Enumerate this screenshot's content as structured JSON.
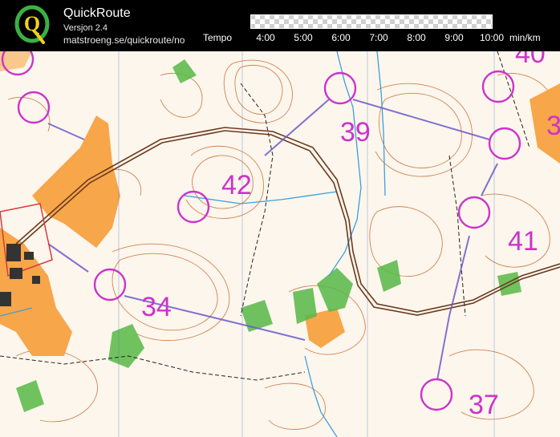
{
  "app": {
    "name": "QuickRoute",
    "version": "Versjon 2.4",
    "url": "matstroeng.se/quickroute/no",
    "logo_letter": "Q"
  },
  "tempo": {
    "label": "Tempo",
    "unit": "min/km",
    "ticks": [
      "4:00",
      "5:00",
      "6:00",
      "7:00",
      "8:00",
      "9:00",
      "10:00"
    ]
  },
  "map": {
    "controls": [
      {
        "number": "39"
      },
      {
        "number": "42"
      },
      {
        "number": "34"
      },
      {
        "number": "41"
      },
      {
        "number": "37"
      },
      {
        "number": "40"
      },
      {
        "number": "3"
      }
    ],
    "colors": {
      "control": "#cc33cc",
      "route": "#6a5acd",
      "open_land": "#f7a64a",
      "forest_green": "#57b847",
      "contour": "#c8703a",
      "water": "#3aa0dd"
    }
  }
}
